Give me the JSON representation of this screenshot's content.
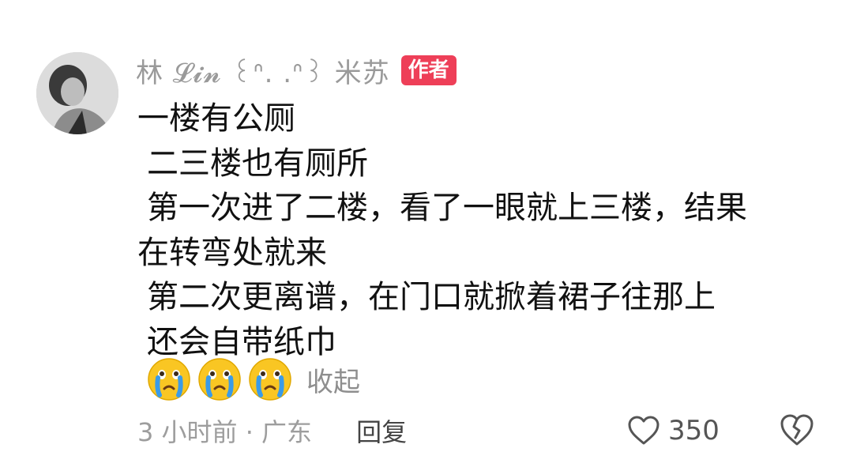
{
  "comment": {
    "author": {
      "name": "林 𝓛𝓲𝓷 ꒰ᐢ. .ᐢ꒱ 米苏",
      "badge": "作者"
    },
    "lines": [
      "一楼有公厕",
      "二三楼也有厕所",
      "第一次进了二楼，看了一眼就上三楼，结果",
      "在转弯处就来",
      "第二次更离谱，在门口就掀着裙子往那上",
      "还会自带纸巾"
    ],
    "emojis": [
      "crying-face-icon",
      "crying-face-icon",
      "crying-face-icon"
    ],
    "collapse_label": "收起",
    "meta": {
      "time_location": "3 小时前 · 广东",
      "reply_label": "回复",
      "like_count": "350"
    }
  },
  "colors": {
    "badge": "#ee3f58",
    "meta_text": "#9d9d9d",
    "body_text": "#111111"
  }
}
